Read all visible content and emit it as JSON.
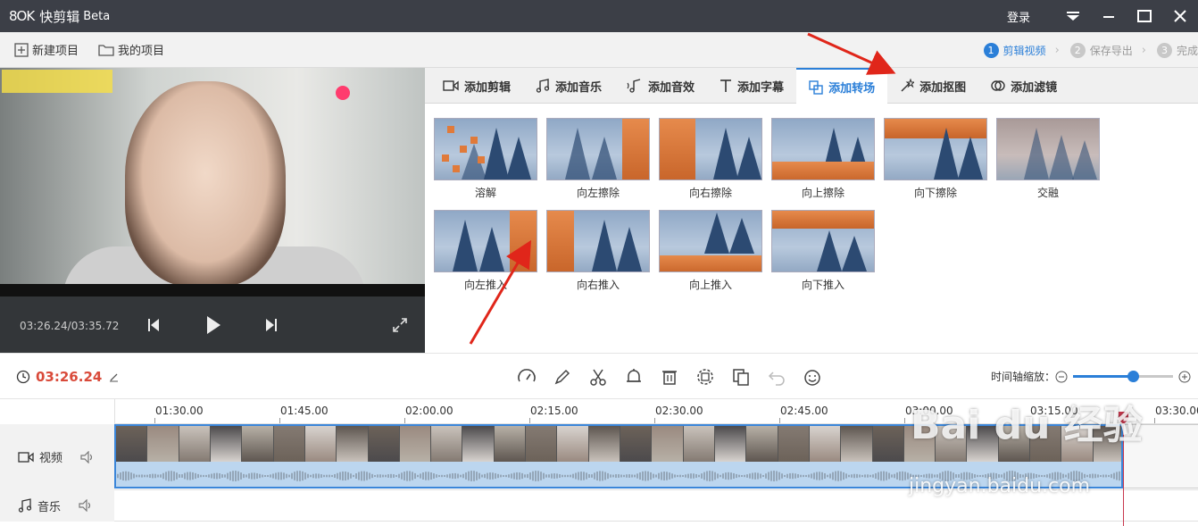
{
  "titlebar": {
    "logo": "8OK",
    "app_name": "快剪辑",
    "beta": "Beta",
    "login": "登录"
  },
  "toolbar": {
    "new_project": "新建项目",
    "my_projects": "我的项目"
  },
  "steps": [
    {
      "num": "1",
      "label": "剪辑视频"
    },
    {
      "num": "2",
      "label": "保存导出"
    },
    {
      "num": "3",
      "label": "完成"
    }
  ],
  "player": {
    "time": "03:26.24/03:35.72"
  },
  "tabs": [
    {
      "label": "添加剪辑"
    },
    {
      "label": "添加音乐"
    },
    {
      "label": "添加音效"
    },
    {
      "label": "添加字幕"
    },
    {
      "label": "添加转场"
    },
    {
      "label": "添加抠图"
    },
    {
      "label": "添加滤镜"
    }
  ],
  "transitions": [
    {
      "label": "溶解"
    },
    {
      "label": "向左擦除"
    },
    {
      "label": "向右擦除"
    },
    {
      "label": "向上擦除"
    },
    {
      "label": "向下擦除"
    },
    {
      "label": "交融"
    },
    {
      "label": "向左推入"
    },
    {
      "label": "向右推入"
    },
    {
      "label": "向上推入"
    },
    {
      "label": "向下推入"
    }
  ],
  "timeline": {
    "current_time": "03:26.24",
    "zoom_label": "时间轴缩放：",
    "zoom_level": 0.6,
    "ticks": [
      "01:30.00",
      "01:45.00",
      "02:00.00",
      "02:15.00",
      "02:30.00",
      "02:45.00",
      "03:00.00",
      "03:15.00",
      "03:30.00"
    ],
    "video_track_label": "视频",
    "music_track_label": "音乐"
  },
  "watermark": {
    "brand": "Bai du 经验",
    "url": "jingyan.baidu.com"
  },
  "colors": {
    "accent": "#2b7fd8",
    "time_red": "#d94a3a",
    "titlebar": "#3c3f47"
  }
}
